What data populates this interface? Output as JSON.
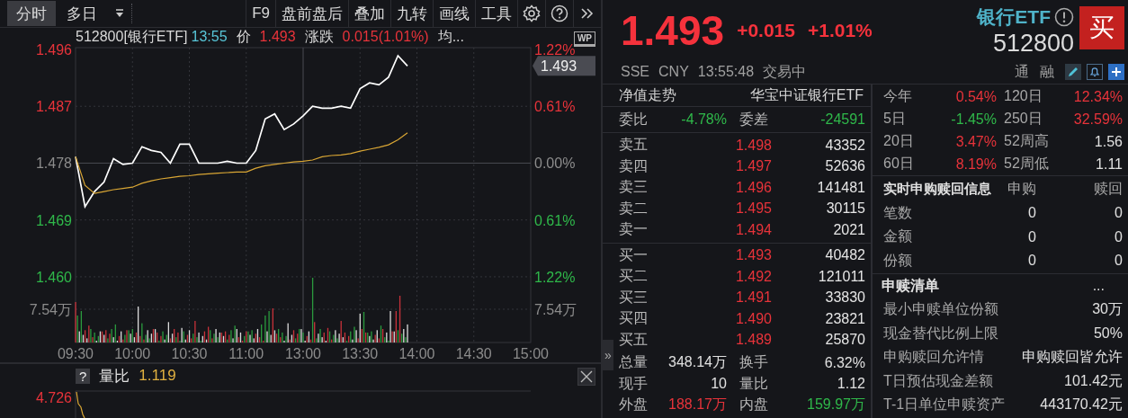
{
  "toolbar": {
    "tabs": [
      {
        "label": "分时",
        "selected": true
      },
      {
        "label": "多日",
        "selected": false
      }
    ],
    "buttons": [
      "F9",
      "盘前盘后",
      "叠加",
      "九转",
      "画线",
      "工具"
    ]
  },
  "chart_header": {
    "code": "512800[银行ETF]",
    "time": "13:55",
    "price_label": "价",
    "price": "1.493",
    "change_label": "涨跌",
    "change": "0.015(1.01%)",
    "more": "均...",
    "wp": "WP"
  },
  "chart": {
    "price_tag": "1.493",
    "y_label_colors": [
      {
        "color": "#e8333a"
      },
      {
        "color": "#e8333a"
      },
      {
        "color": "#8c8c8c"
      },
      {
        "color": "#2fb84a"
      },
      {
        "color": "#2fb84a"
      }
    ],
    "right_labels": [
      {
        "text": "1.22%",
        "color": "#e8333a"
      },
      {
        "text": "0.61%",
        "color": "#e8333a"
      },
      {
        "text": "0.00%",
        "color": "#8c8c8c"
      },
      {
        "text": "0.61%",
        "color": "#2fb84a"
      },
      {
        "text": "1.22%",
        "color": "#2fb84a"
      }
    ],
    "volume_label_left": "7.54万",
    "volume_label_right": "7.54万",
    "chart_data": {
      "type": "line",
      "categories": [
        "09:30",
        null,
        null,
        null,
        null,
        null,
        "10:00",
        null,
        null,
        null,
        null,
        null,
        "10:30",
        null,
        null,
        null,
        null,
        null,
        "11:00",
        null,
        null,
        null,
        null,
        null,
        "13:00",
        null,
        null,
        null,
        null,
        null,
        "13:30",
        null,
        null,
        null,
        null,
        null,
        "14:00",
        null,
        null,
        null,
        null,
        null,
        "14:30",
        null,
        null,
        null,
        null,
        null,
        "15:00"
      ],
      "series": [
        {
          "color": "#ffffff",
          "values": [
            1.479,
            1.4711,
            1.4735,
            1.475,
            1.4787,
            1.4778,
            1.478,
            1.4806,
            1.48,
            1.4797,
            1.478,
            1.481,
            1.481,
            1.478,
            1.478,
            1.478,
            1.4783,
            1.478,
            1.478,
            1.48,
            1.485,
            1.4858,
            1.4833,
            1.4842,
            1.4855,
            1.487,
            1.4867,
            1.4867,
            1.487,
            1.4867,
            1.4898,
            1.4907,
            1.4904,
            1.4916,
            1.495,
            1.4934,
            null,
            null,
            null,
            null,
            null,
            null,
            null,
            null,
            null,
            null,
            null,
            null,
            null
          ]
        },
        {
          "color": "#d9a634",
          "values": [
            1.479,
            1.4745,
            1.4732,
            1.4735,
            1.4738,
            1.474,
            1.4742,
            1.4748,
            1.4752,
            1.4755,
            1.4757,
            1.4759,
            1.476,
            1.4762,
            1.4763,
            1.4764,
            1.4765,
            1.4766,
            1.4766,
            1.4772,
            1.4776,
            1.4778,
            1.478,
            1.4782,
            1.4783,
            1.4785,
            1.479,
            1.4792,
            1.4793,
            1.4795,
            1.4799,
            1.4802,
            1.4805,
            1.4809,
            1.4817,
            1.4828,
            null,
            null,
            null,
            null,
            null,
            null,
            null,
            null,
            null,
            null,
            null,
            null,
            null
          ]
        }
      ],
      "ylim": [
        1.4496,
        1.496
      ],
      "grid": true,
      "yticks": [
        {
          "value": 1.496,
          "label": "1.496"
        },
        {
          "value": 1.487,
          "label": "1.487"
        },
        {
          "value": 1.478,
          "label": "1.478"
        },
        {
          "value": 1.469,
          "label": "1.469"
        },
        {
          "value": 1.46,
          "label": "1.460"
        }
      ]
    }
  },
  "ratio_pane": {
    "help": "?",
    "label": "量比",
    "value": "1.119",
    "axis_label": "4.726"
  },
  "quote": {
    "price": "1.493",
    "change": "+0.015",
    "change_pct": "+1.01%",
    "name": "银行ETF",
    "code": "512800",
    "buy_button": "买",
    "exchange": "SSE",
    "currency": "CNY",
    "time": "13:55:48",
    "status": "交易中",
    "tags": [
      "通",
      "融"
    ]
  },
  "net_value": {
    "label": "净值走势",
    "fund": "华宝中证银行ETF"
  },
  "order_ratio": [
    {
      "label": "委比",
      "value": "-4.78%",
      "color": "#2fb84a"
    },
    {
      "label": "委差",
      "value": "-24591",
      "color": "#2fb84a"
    }
  ],
  "asks": [
    {
      "label": "卖五",
      "price": "1.498",
      "volume": "43352"
    },
    {
      "label": "卖四",
      "price": "1.497",
      "volume": "52636"
    },
    {
      "label": "卖三",
      "price": "1.496",
      "volume": "141481"
    },
    {
      "label": "卖二",
      "price": "1.495",
      "volume": "30115"
    },
    {
      "label": "卖一",
      "price": "1.494",
      "volume": "2021"
    }
  ],
  "bids": [
    {
      "label": "买一",
      "price": "1.493",
      "volume": "40482"
    },
    {
      "label": "买二",
      "price": "1.492",
      "volume": "121011"
    },
    {
      "label": "买三",
      "price": "1.491",
      "volume": "33830"
    },
    {
      "label": "买四",
      "price": "1.490",
      "volume": "23821"
    },
    {
      "label": "买五",
      "price": "1.489",
      "volume": "25870"
    }
  ],
  "trade_stats": [
    {
      "cells": [
        {
          "label": "总量",
          "value": "348.14万",
          "color": "#e0e0e0"
        },
        {
          "label": "换手",
          "value": "6.32%",
          "color": "#e0e0e0"
        }
      ]
    },
    {
      "cells": [
        {
          "label": "现手",
          "value": "10",
          "color": "#e0e0e0"
        },
        {
          "label": "量比",
          "value": "1.12",
          "color": "#e0e0e0"
        }
      ]
    },
    {
      "cells": [
        {
          "label": "外盘",
          "value": "188.17万",
          "color": "#e8333a"
        },
        {
          "label": "内盘",
          "value": "159.97万",
          "color": "#2fb84a"
        }
      ]
    }
  ],
  "side_tab": "»",
  "performance": [
    {
      "cells": [
        {
          "label": "今年",
          "value": "0.54%",
          "color": "#e8333a"
        },
        {
          "label": "120日",
          "value": "12.34%",
          "color": "#e8333a"
        }
      ]
    },
    {
      "cells": [
        {
          "label": "5日",
          "value": "-1.45%",
          "color": "#2fb84a"
        },
        {
          "label": "250日",
          "value": "32.59%",
          "color": "#e8333a"
        }
      ]
    },
    {
      "cells": [
        {
          "label": "20日",
          "value": "3.47%",
          "color": "#e8333a"
        },
        {
          "label": "52周高",
          "value": "1.56",
          "color": "#e0e0e0"
        }
      ]
    },
    {
      "cells": [
        {
          "label": "60日",
          "value": "8.19%",
          "color": "#e8333a"
        },
        {
          "label": "52周低",
          "value": "1.11",
          "color": "#e0e0e0"
        }
      ]
    }
  ],
  "creation_redemption": {
    "title": "实时申购赎回信息",
    "columns": [
      "申购",
      "赎回"
    ],
    "rows": [
      {
        "label": "笔数",
        "values": [
          "0",
          "0"
        ]
      },
      {
        "label": "金额",
        "values": [
          "0",
          "0"
        ]
      },
      {
        "label": "份额",
        "values": [
          "0",
          "0"
        ]
      }
    ]
  },
  "creation_list": {
    "title": "申赎清单",
    "more": "...",
    "rows": [
      {
        "label": "最小申赎单位份额",
        "value": "30万"
      },
      {
        "label": "现金替代比例上限",
        "value": "50%"
      },
      {
        "label": "申购赎回允许情",
        "value": "申购赎回皆允许"
      },
      {
        "label": "T日预估现金差额",
        "value": "101.42元"
      },
      {
        "label": "T-1日单位申赎资产",
        "value": "443170.42元"
      }
    ]
  }
}
